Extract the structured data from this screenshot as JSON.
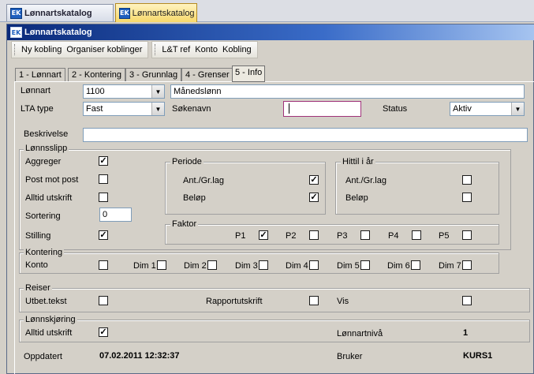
{
  "outer_tabs": [
    {
      "label": "Lønnartskatalog",
      "logo": "EK"
    },
    {
      "label": "Lønnartskatalog",
      "logo": "EK"
    }
  ],
  "window": {
    "title": "Lønnartskatalog",
    "logo": "EK"
  },
  "toolbar": {
    "group1": [
      "Ny kobling",
      "Organiser koblinger"
    ],
    "group2": [
      "L&T ref",
      "Konto",
      "Kobling"
    ]
  },
  "tabs": [
    "1 - Lønnart",
    "2 - Kontering",
    "3 - Grunnlag",
    "4 - Grenser",
    "5 - Info"
  ],
  "form": {
    "lonnart_label": "Lønnart",
    "lonnart_value": "1100",
    "lonnart_name": "Månedslønn",
    "lta_label": "LTA type",
    "lta_value": "Fast",
    "sokenavn_label": "Søkenavn",
    "sokenavn_value": "",
    "status_label": "Status",
    "status_value": "Aktiv",
    "beskrivelse_label": "Beskrivelse",
    "beskrivelse_value": ""
  },
  "lonnsslipp": {
    "title": "Lønnsslipp",
    "aggreger": "Aggreger",
    "post_mot_post": "Post mot post",
    "alltid_utskrift": "Alltid utskrift",
    "sortering": "Sortering",
    "sortering_value": "0",
    "stilling": "Stilling",
    "checks": {
      "aggreger": true,
      "post_mot_post": false,
      "alltid_utskrift": false,
      "stilling": true
    }
  },
  "periode": {
    "title": "Periode",
    "ant": "Ant./Gr.lag",
    "belop": "Beløp",
    "checks": {
      "ant": true,
      "belop": true
    }
  },
  "hittil": {
    "title": "Hittil i år",
    "ant": "Ant./Gr.lag",
    "belop": "Beløp",
    "checks": {
      "ant": false,
      "belop": false
    }
  },
  "faktor": {
    "title": "Faktor",
    "items": [
      {
        "label": "P1",
        "checked": true
      },
      {
        "label": "P2",
        "checked": false
      },
      {
        "label": "P3",
        "checked": false
      },
      {
        "label": "P4",
        "checked": false
      },
      {
        "label": "P5",
        "checked": false
      }
    ]
  },
  "kontering": {
    "title": "Kontering",
    "items": [
      {
        "label": "Konto",
        "checked": false
      },
      {
        "label": "Dim 1",
        "checked": false
      },
      {
        "label": "Dim 2",
        "checked": false
      },
      {
        "label": "Dim 3",
        "checked": false
      },
      {
        "label": "Dim 4",
        "checked": false
      },
      {
        "label": "Dim 5",
        "checked": false
      },
      {
        "label": "Dim 6",
        "checked": false
      },
      {
        "label": "Dim 7",
        "checked": false
      }
    ]
  },
  "reiser": {
    "title": "Reiser",
    "utbet": "Utbet.tekst",
    "rapport": "Rapportutskrift",
    "vis": "Vis",
    "checks": {
      "utbet": false,
      "rapport": false,
      "vis": false
    }
  },
  "lonnskjoring": {
    "title": "Lønnskjøring",
    "alltid": "Alltid utskrift",
    "alltid_checked": true,
    "niva_label": "Lønnartnivå",
    "niva_value": "1"
  },
  "footer": {
    "oppdatert_label": "Oppdatert",
    "oppdatert_value": "07.02.2011 12:32:37",
    "bruker_label": "Bruker",
    "bruker_value": "KURS1"
  }
}
